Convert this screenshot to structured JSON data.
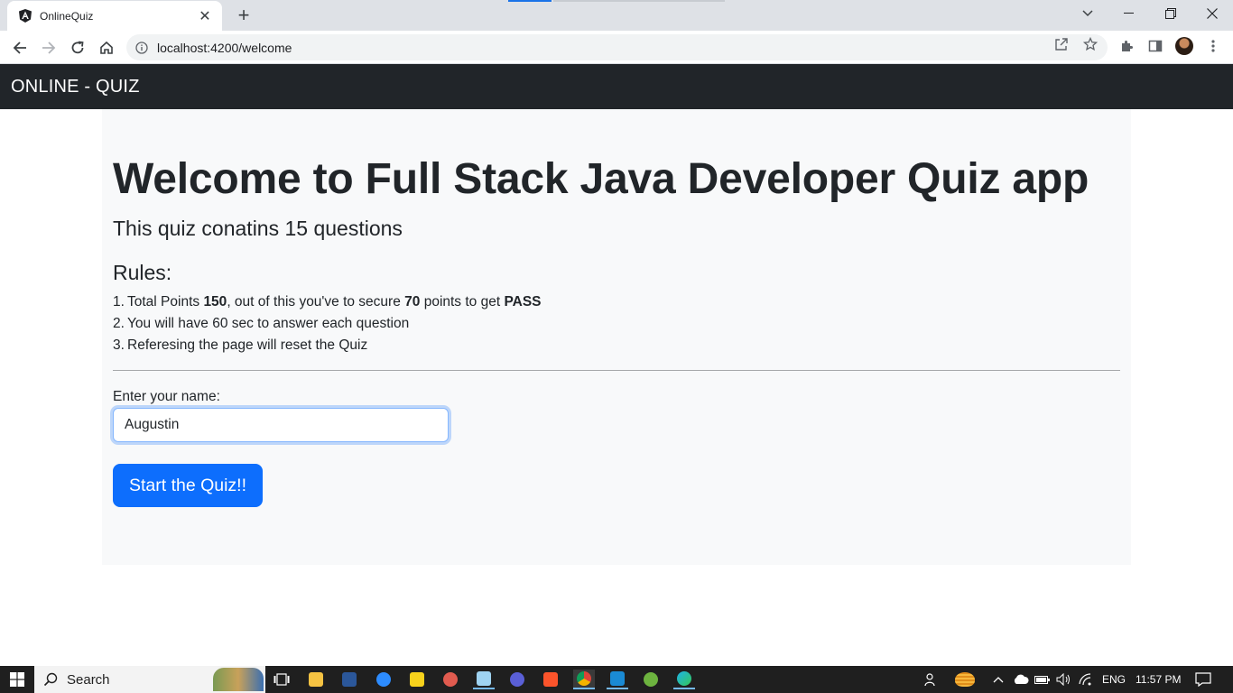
{
  "browser": {
    "tab_title": "OnlineQuiz",
    "url": "localhost:4200/welcome",
    "new_tab_symbol": "+",
    "close_symbol": "✕"
  },
  "app": {
    "brand": "ONLINE - QUIZ"
  },
  "welcome": {
    "headline": "Welcome to Full Stack Java Developer Quiz app",
    "lead": "This quiz conatins 15 questions",
    "rules_title": "Rules:",
    "rules": [
      {
        "num": "1.",
        "p1": "Total Points ",
        "b1": "150",
        "p2": ", out of this you've to secure ",
        "b2": "70",
        "p3": " points to get ",
        "b3": "PASS"
      },
      {
        "num": "2.",
        "text": "You will have 60 sec to answer each question"
      },
      {
        "num": "3.",
        "text": "Referesing the page will reset the Quiz"
      }
    ],
    "name_label": "Enter your name:",
    "name_value": "Augustin",
    "start_label": "Start the Quiz!!"
  },
  "taskbar": {
    "search_label": "Search",
    "language": "ENG",
    "time": "11:57 PM"
  },
  "colors": {
    "navbar": "#212529",
    "jumbotron": "#f8f9fa",
    "primary": "#0d6efd"
  }
}
